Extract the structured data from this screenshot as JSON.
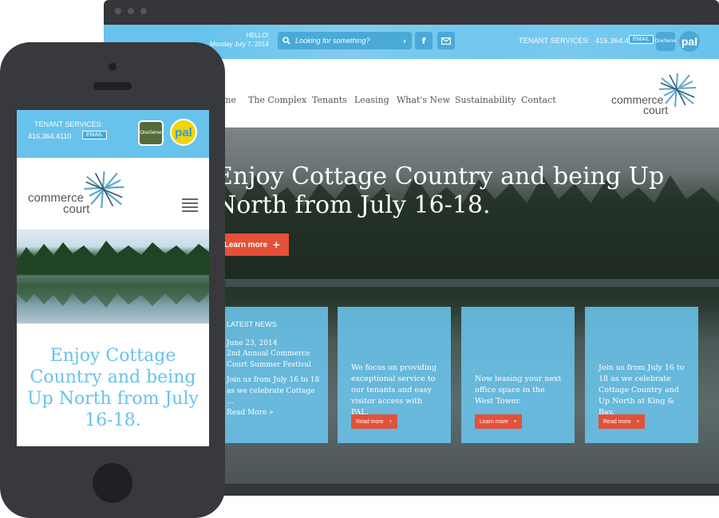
{
  "desktop": {
    "hello": "HELLO!",
    "date": "Monday July 7, 2014",
    "search_placeholder": "Looking for something?",
    "tenant_services": "TENANT SERVICES:",
    "tenant_phone": "416.364.4110",
    "email_label": "EMAIL",
    "oneserve_label": "OneServe",
    "pal_label": "pal",
    "nav": [
      "me",
      "The Complex",
      "Tenants",
      "Leasing",
      "What's New",
      "Sustainability",
      "Contact"
    ],
    "logo_line1": "commerce",
    "logo_line2": "court",
    "hero_title": "Enjoy Cottage Country and being Up North from July 16-18.",
    "hero_button": "Learn more",
    "news": {
      "heading": "LATEST NEWS",
      "date": "June 23, 2014",
      "title": "2nd Annual Commerce Court Summer Festival",
      "excerpt": "Join us from July 16 to 18 as we celebrate Cottage ...",
      "read_more": "Read More »"
    },
    "cards": [
      {
        "text": "We focus on providing exceptional service to our tenants and easy visitor access with PAL.",
        "button": "Read more"
      },
      {
        "text": "Now leasing your next office space in the West Tower.",
        "button": "Learn more"
      },
      {
        "text": "Join us from July 16 to 18 as we celebrate Cottage Country and Up North at King & Bay.",
        "button": "Read more"
      }
    ]
  },
  "mobile": {
    "tenant_services": "TENANT SERVICES:",
    "tenant_phone": "416.364.4110",
    "email_label": "EMAIL",
    "oneserve_label": "OneServe",
    "pal_label": "pal",
    "logo_line1": "commerce",
    "logo_line2": "court",
    "hero_title": "Enjoy Cottage Country and being Up North from July 16-18."
  },
  "colors": {
    "brand_blue": "#67c3ec",
    "accent_red": "#e35139",
    "frame_dark": "#38393d"
  }
}
